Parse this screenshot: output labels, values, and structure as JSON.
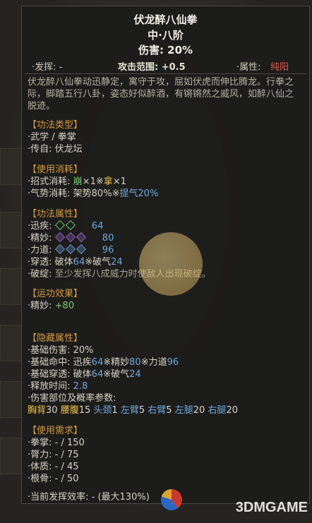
{
  "skill": {
    "name": "伏龙醉八仙拳",
    "rank": "中·八阶",
    "damage": "伤害: 20%",
    "bar": {
      "play": "·发挥: -",
      "range": "攻击范围: +0.5",
      "attr_label": "·属性:",
      "attr_value": "纯阳"
    },
    "description": "伏龙醉八仙拳动迅静定，寓守于攻，屈如伏虎而伸比腾龙。行拳之际，脚踏五行八卦，姿态好似醉酒，有锵锵然之威风，如醉八仙之脱迹。"
  },
  "type_section": {
    "title": "【功法类型】",
    "lines": [
      "·武学 / 拳掌",
      "·传自: 伏龙坛"
    ]
  },
  "cost_section": {
    "title": "【使用消耗】",
    "move_label": "·招式消耗:",
    "move_a": "崩",
    "move_a_n": "×1※",
    "move_b": "拿",
    "move_b_n": "×1",
    "qi_label": "·气势消耗:",
    "qi_a": "架势80%",
    "qi_sep": "※",
    "qi_b": "提气20%"
  },
  "attr_section": {
    "title": "【功法属性】",
    "speed_label": "·迅疾:",
    "speed_value": "64",
    "skill_label": "·精妙:",
    "skill_value": "80",
    "power_label": "·力道:",
    "power_value": "96",
    "pierce_label": "·穿透:",
    "pierce_a": "破体",
    "pierce_a_v": "64",
    "pierce_sep": "※",
    "pierce_b": "破气",
    "pierce_b_v": "24",
    "break_label": "·破绽:",
    "break_text": "至少发挥八成威力时使敌人出现破绽。"
  },
  "effect_section": {
    "title": "【运功效果】",
    "label": "·精妙:",
    "value": "+80"
  },
  "hidden_section": {
    "title": "【隐藏属性】",
    "base_dmg": "·基础伤害: 20%",
    "hit_label": "·基础命中:",
    "hit_a": "迅疾",
    "hit_a_v": "64",
    "hit_sep1": "※",
    "hit_b": "精妙",
    "hit_b_v": "80",
    "hit_sep2": "※",
    "hit_c": "力道",
    "hit_c_v": "96",
    "pen_label": "·基础穿透:",
    "pen_a": "破体",
    "pen_a_v": "64",
    "pen_sep": "※",
    "pen_b": "破气",
    "pen_b_v": "24",
    "release_label": "·释放时间:",
    "release_value": "2.8",
    "parts_label": "·伤害部位及概率参数:",
    "parts": [
      {
        "part": "胸背",
        "n": "30"
      },
      {
        "part": "腰腹",
        "n": "15"
      },
      {
        "part": "头颈",
        "n": "1"
      },
      {
        "part": "左臂",
        "n": "5"
      },
      {
        "part": "右臂",
        "n": "5"
      },
      {
        "part": "左腿",
        "n": "20"
      },
      {
        "part": "右腿",
        "n": "20"
      }
    ]
  },
  "req_section": {
    "title": "【使用需求】",
    "lines": [
      "·拳掌: - / 150",
      "·膂力: - / 75",
      "·体质: - / 45",
      "·根骨: - / 50"
    ],
    "efficiency": "·当前发挥效率: - (最大130%)"
  },
  "watermark": "3DMGAME",
  "colors": {
    "section": "#d19a3e",
    "green": "#7dce6e",
    "blue": "#6fa8dc",
    "yellow": "#f3c74b",
    "attr": "#e05a4a"
  }
}
